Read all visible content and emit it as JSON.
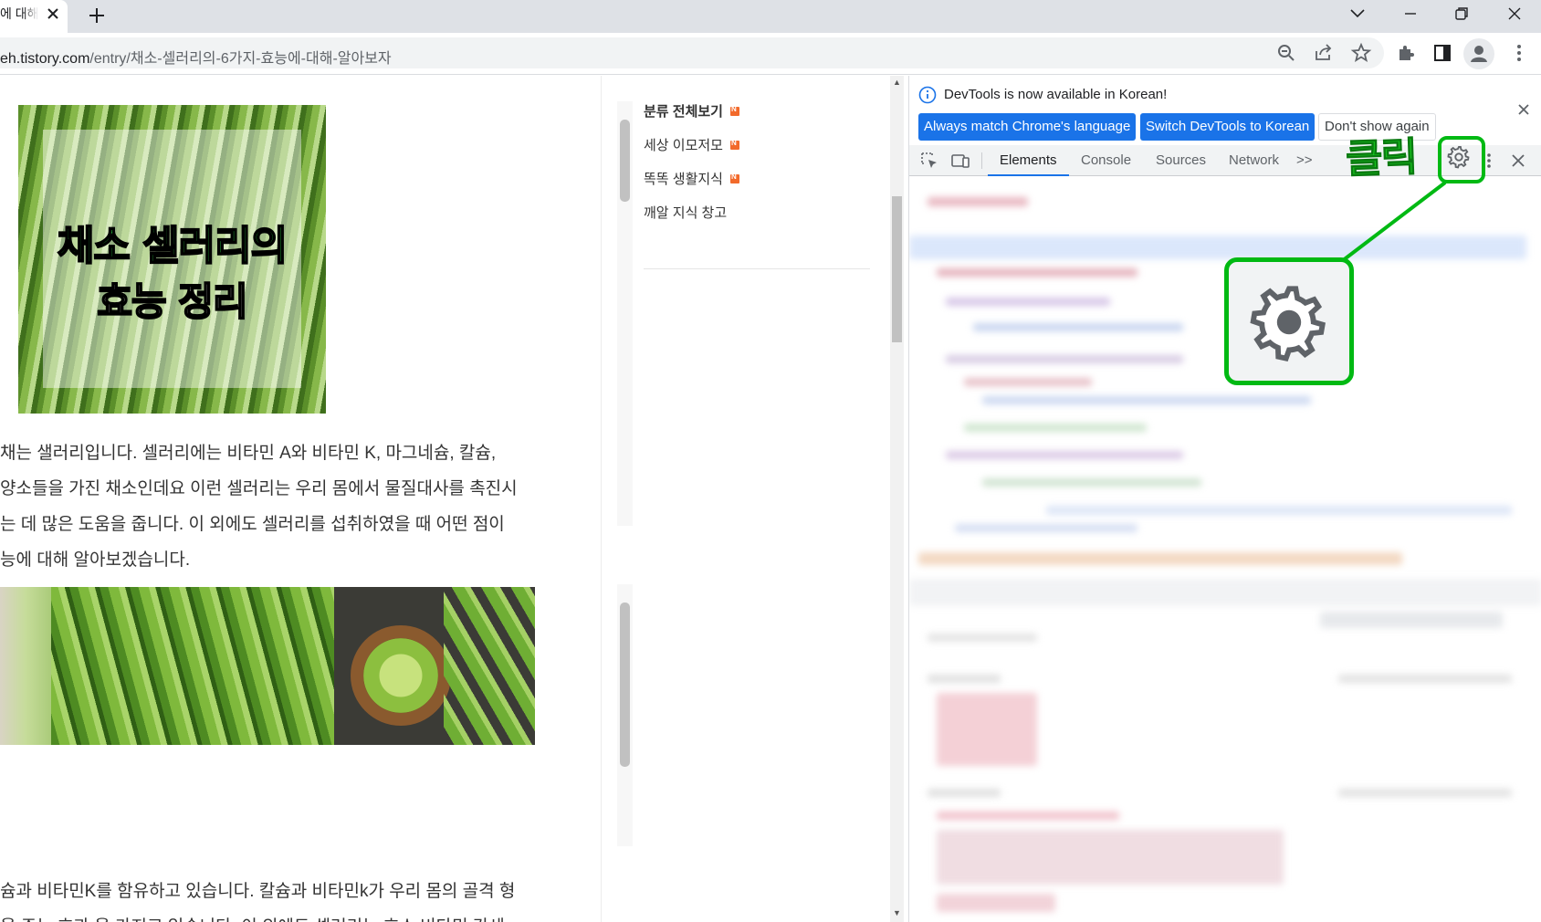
{
  "browser": {
    "tab_title": "에 대해",
    "new_tab_symbol": "+",
    "url_host": "eh.tistory.com",
    "url_path": "/entry/채소-셀러리의-6가지-효능에-대해-알아보자"
  },
  "article": {
    "hero_line1": "채소 셀러리의",
    "hero_line2": "효능 정리",
    "para1": [
      "채는 샐러리입니다. 셀러리에는 비타민 A와 비타민 K, 마그네슘, 칼슘,",
      "양소들을 가진 채소인데요 이런 셀러리는 우리 몸에서 물질대사를 촉진시",
      "는 데 많은 도움을 줍니다. 이 외에도 셀러리를 섭취하였을 때 어떤 점이",
      "능에 대해 알아보겠습니다."
    ],
    "para2": [
      "슘과 비타민K를 함유하고 있습니다. 칼슘과 비타민k가 우리 몸의 골격 형",
      "을 주는 효과 을 가지고 있습니다. 이 외에도 셀러리는 효소 비타민 간세"
    ]
  },
  "sidebar": {
    "categories": [
      {
        "label": "분류 전체보기",
        "new": true
      },
      {
        "label": "세상 이모저모",
        "new": true
      },
      {
        "label": "똑똑 생활지식",
        "new": true
      },
      {
        "label": "깨알 지식 창고",
        "new": false
      }
    ]
  },
  "devtools": {
    "info_message": "DevTools is now available in Korean!",
    "btn_match": "Always match Chrome's language",
    "btn_switch": "Switch DevTools to Korean",
    "btn_dont_show": "Don't show again",
    "tabs": [
      "Elements",
      "Console",
      "Sources",
      "Network"
    ],
    "more_tabs": ">>",
    "active_tab": "Elements"
  },
  "annotation": {
    "label": "클릭",
    "color": "#00b913"
  },
  "colors": {
    "accent": "#1a73e8",
    "annotation_green": "#00b913",
    "new_badge": "#f26a2b"
  },
  "icons": [
    "close-icon",
    "plus-icon",
    "chevron-down-icon",
    "minimize-icon",
    "restore-icon",
    "zoom-out-icon",
    "share-icon",
    "star-icon",
    "puzzle-icon",
    "side-panel-icon",
    "profile-icon",
    "kebab-menu-icon",
    "info-icon",
    "inspect-icon",
    "device-toolbar-icon",
    "gear-icon"
  ]
}
